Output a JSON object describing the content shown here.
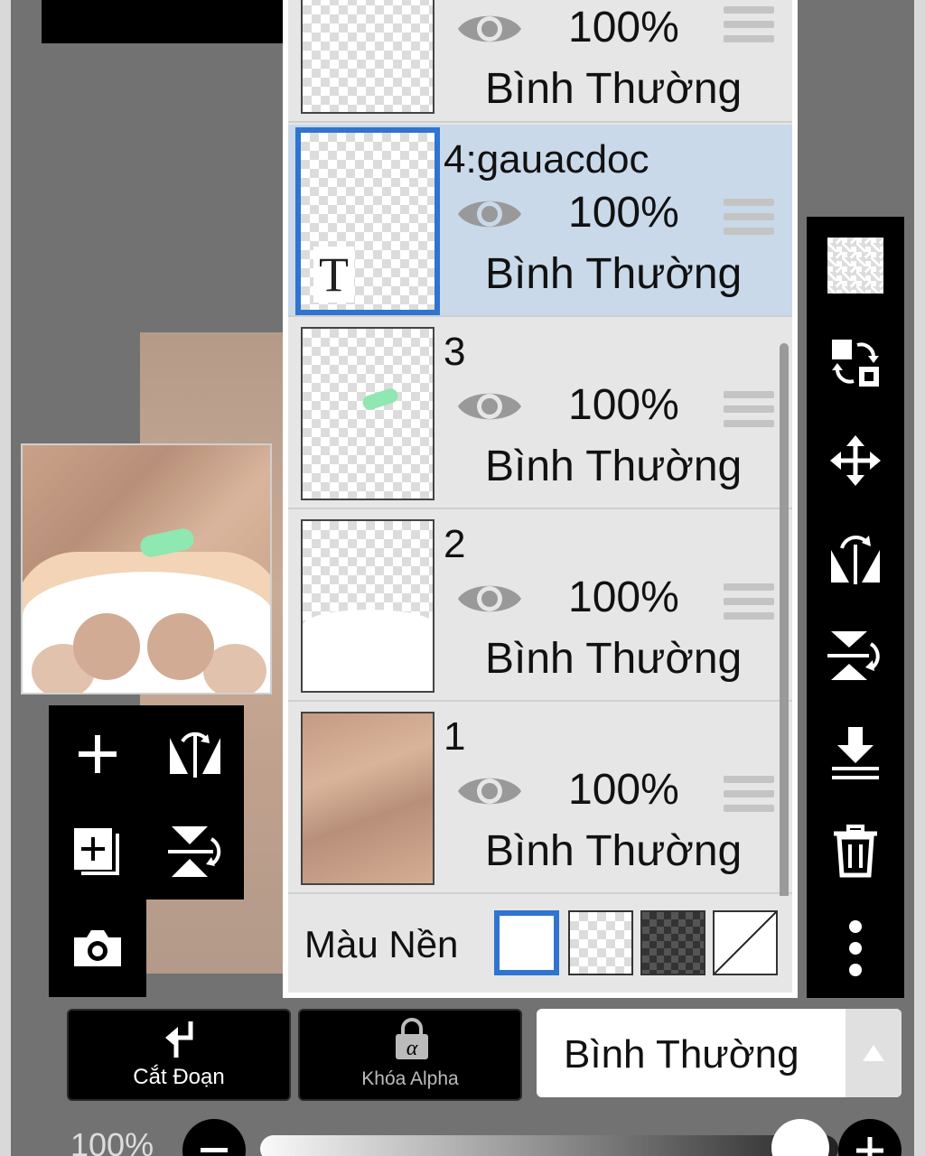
{
  "layers": [
    {
      "name": "",
      "opacity": "100%",
      "blend": "Bình Thường"
    },
    {
      "name": "4:gauacdoc",
      "opacity": "100%",
      "blend": "Bình Thường",
      "text_icon": "T"
    },
    {
      "name": "3",
      "opacity": "100%",
      "blend": "Bình Thường"
    },
    {
      "name": "2",
      "opacity": "100%",
      "blend": "Bình Thường"
    },
    {
      "name": "1",
      "opacity": "100%",
      "blend": "Bình Thường"
    }
  ],
  "background_color": {
    "label": "Màu Nền"
  },
  "bottom": {
    "clip_label": "Cắt Đoạn",
    "alpha_lock_label": "Khóa Alpha",
    "blend_mode": "Bình Thường",
    "opacity_value": "100%"
  },
  "colors": {
    "accent": "#2f74cf",
    "selected_row": "#c9d9ea",
    "panel": "#e6e6e6"
  }
}
